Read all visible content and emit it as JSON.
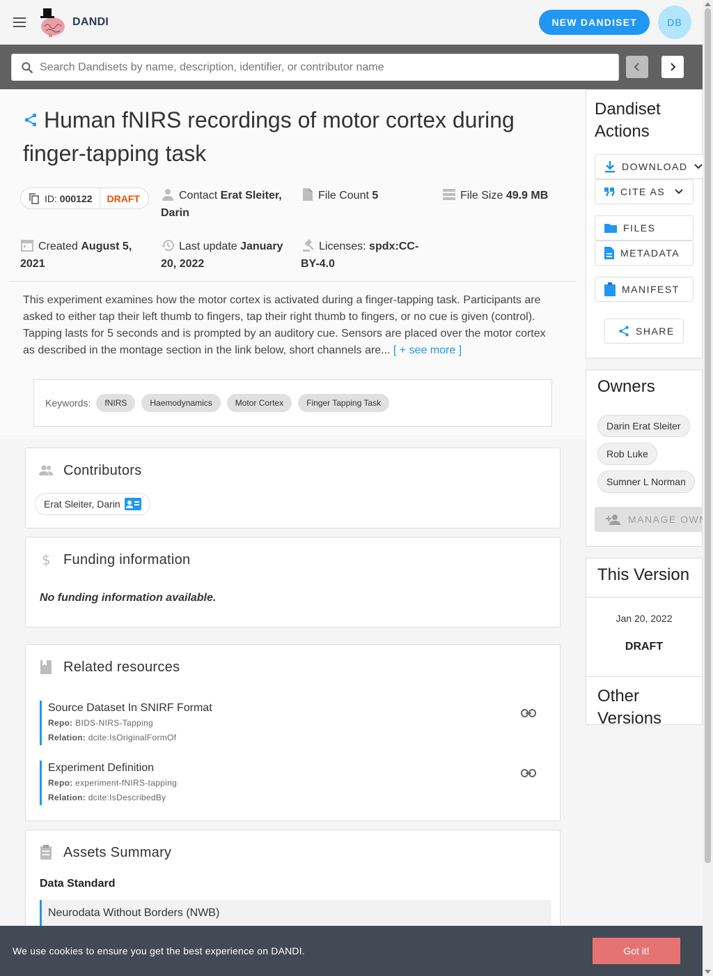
{
  "appbar": {
    "brand": "DANDI",
    "new_button": "NEW DANDISET",
    "avatar_initials": "DB"
  },
  "search": {
    "placeholder": "Search Dandisets by name, description, identifier, or contributor name"
  },
  "dandiset": {
    "title": "Human fNIRS recordings of motor cortex during finger-tapping task",
    "id_label": "ID:",
    "id": "000122",
    "status": "DRAFT",
    "contact_label": "Contact",
    "contact_value": "Erat Sleiter, Darin",
    "file_count_label": "File Count",
    "file_count": "5",
    "file_size_label": "File Size",
    "file_size": "49.9 MB",
    "created_label": "Created",
    "created": "August 5, 2021",
    "updated_label": "Last update",
    "updated": "January 20, 2022",
    "license_label": "Licenses:",
    "license": "spdx:CC-BY-4.0",
    "description": "This experiment examines how the motor cortex is activated during a finger-tapping task. Participants are asked to either tap their left thumb to fingers, tap their right thumb to fingers, or no cue is given (control). Tapping lasts for 5 seconds and is prompted by an auditory cue. Sensors are placed over the motor cortex as described in the montage section in the link below, short channels are...",
    "see_more": "[ + see more ]",
    "keywords_label": "Keywords:",
    "keywords": [
      "fNIRS",
      "Haemodynamics",
      "Motor Cortex",
      "Finger Tapping Task"
    ]
  },
  "contributors": {
    "title": "Contributors",
    "items": [
      "Erat Sleiter, Darin"
    ]
  },
  "funding": {
    "title": "Funding information",
    "empty_text": "No funding information available."
  },
  "related": {
    "title": "Related resources",
    "repo_label": "Repo:",
    "relation_label": "Relation:",
    "items": [
      {
        "name": "Source Dataset In SNIRF Format",
        "repo": "BIDS-NIRS-Tapping",
        "relation": "dcite:IsOriginalFormOf"
      },
      {
        "name": "Experiment Definition",
        "repo": "experiment-fNIRS-tapping",
        "relation": "dcite:IsDescribedBy"
      }
    ]
  },
  "assets": {
    "title": "Assets Summary",
    "data_standard_label": "Data Standard",
    "data_standard": "Neurodata Without Borders (NWB)"
  },
  "sidebar": {
    "actions_title": "Dandiset Actions",
    "download": "DOWNLOAD",
    "cite": "CITE AS",
    "files": "FILES",
    "metadata": "METADATA",
    "manifest": "MANIFEST",
    "share": "SHARE",
    "owners_title": "Owners",
    "owners": [
      "Darin Erat Sleiter",
      "Rob Luke",
      "Sumner L Norman"
    ],
    "manage_owners": "MANAGE OWNERS",
    "version_title": "This Version",
    "version_date": "Jan 20, 2022",
    "version_status": "DRAFT",
    "other_versions_title": "Other Versions"
  },
  "cookie": {
    "text": "We use cookies to ensure you get the best experience on DANDI.",
    "button": "Got it!"
  },
  "colors": {
    "primary": "#2196f3",
    "draft": "#e65100",
    "cookie_bg": "#424a55",
    "cookie_button": "#e57373"
  }
}
